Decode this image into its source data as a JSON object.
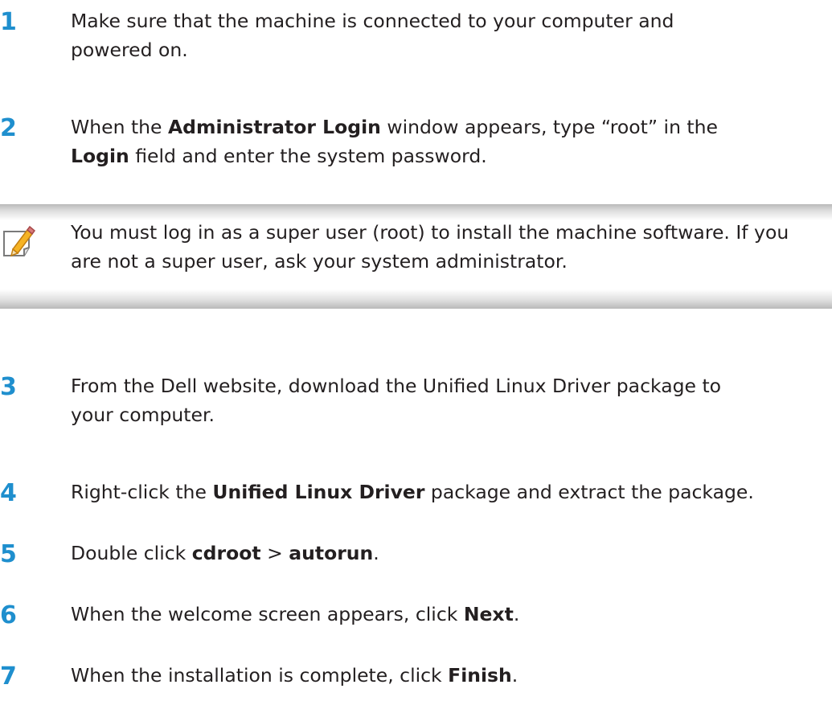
{
  "steps_before": [
    {
      "number": "1",
      "line1": "Make sure that the machine is connected to your computer and",
      "line2": "powered on."
    },
    {
      "number": "2",
      "line1_pre": "When the ",
      "line1_bold": "Administrator Login",
      "line1_post": " window appears, type “root” in the",
      "line2_bold": "Login",
      "line2_post": " field and enter the system password."
    }
  ],
  "note": {
    "icon": "pencil-note-icon",
    "line1": "You must log in as a super user (root) to install the machine software. If you",
    "line2": "are not a super user, ask your system administrator."
  },
  "steps_after": [
    {
      "number": "3",
      "line1": "From the Dell website, download the Unified Linux Driver package to",
      "line2": "your computer."
    },
    {
      "number": "4",
      "pre": "Right-click the ",
      "bold": "Unified Linux Driver",
      "post": " package and extract the package."
    },
    {
      "number": "5",
      "pre": "Double click ",
      "bold1": "cdroot",
      "mid": " > ",
      "bold2": "autorun",
      "post": "."
    },
    {
      "number": "6",
      "pre": "When the welcome screen appears, click ",
      "bold": "Next",
      "post": "."
    },
    {
      "number": "7",
      "pre": "When the installation is complete, click ",
      "bold": "Finish",
      "post": "."
    }
  ],
  "colors": {
    "step_number": "#1f8fce",
    "text": "#231f20",
    "note_band": "#b9b9b9"
  }
}
